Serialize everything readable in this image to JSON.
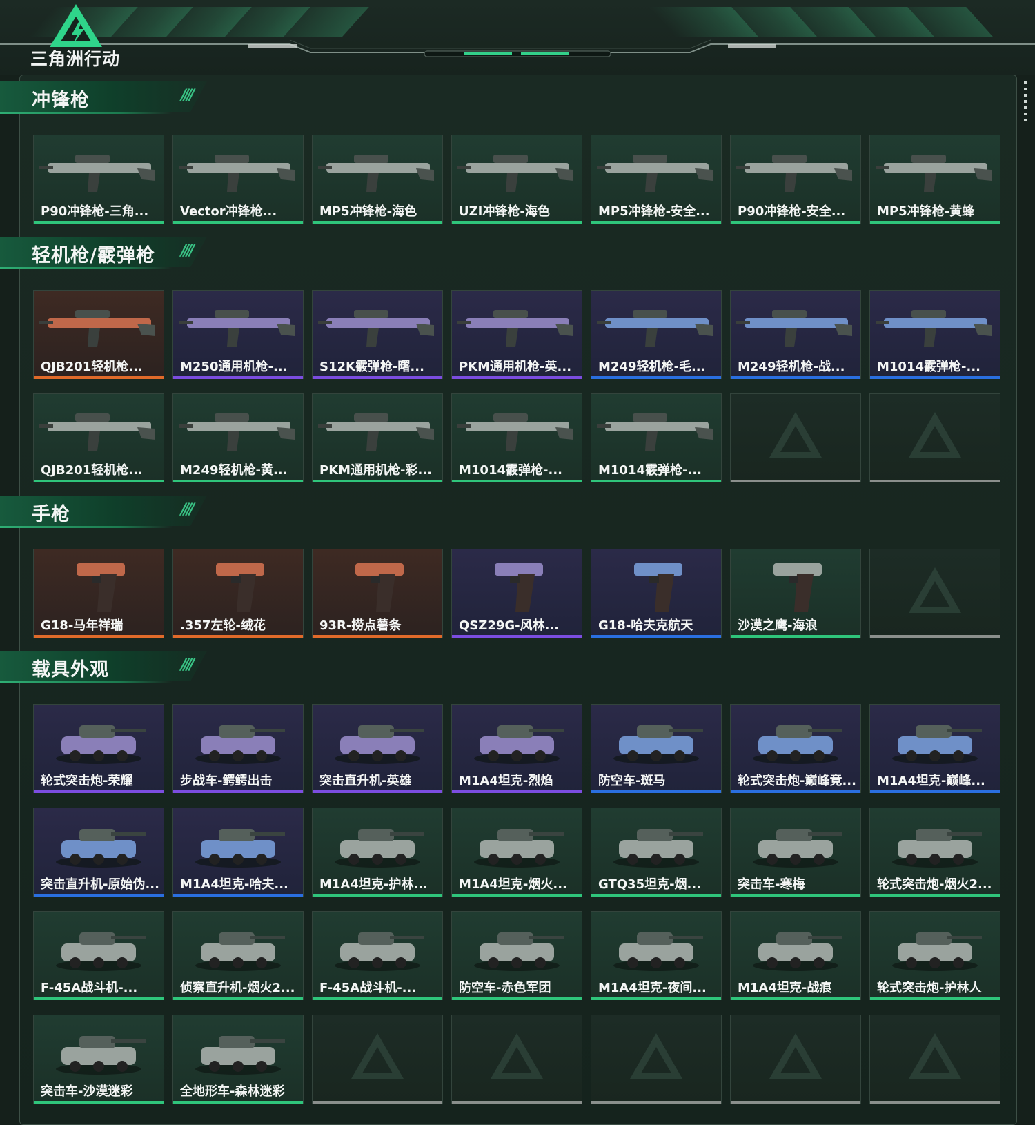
{
  "app": {
    "logo_text": "三角洲行动",
    "logo_icon": "delta-triangle-icon"
  },
  "colors": {
    "green": "#2fc57b",
    "purple": "#7b4de0",
    "blue": "#2a6fe0",
    "orange": "#e06a2a",
    "gray": "#8a8f8c"
  },
  "sections": [
    {
      "title": "冲锋枪",
      "rows": [
        [
          {
            "name": "P90冲锋枪-三角...",
            "rarity": "green"
          },
          {
            "name": "Vector冲锋枪...",
            "rarity": "green"
          },
          {
            "name": "MP5冲锋枪-海色",
            "rarity": "green"
          },
          {
            "name": "UZI冲锋枪-海色",
            "rarity": "green"
          },
          {
            "name": "MP5冲锋枪-安全...",
            "rarity": "green"
          },
          {
            "name": "P90冲锋枪-安全...",
            "rarity": "green"
          },
          {
            "name": "MP5冲锋枪-黄蜂",
            "rarity": "green"
          }
        ]
      ]
    },
    {
      "title": "轻机枪/霰弹枪",
      "rows": [
        [
          {
            "name": "QJB201轻机枪...",
            "rarity": "orange"
          },
          {
            "name": "M250通用机枪-...",
            "rarity": "purple"
          },
          {
            "name": "S12K霰弹枪-曙...",
            "rarity": "purple"
          },
          {
            "name": "PKM通用机枪-英...",
            "rarity": "purple"
          },
          {
            "name": "M249轻机枪-毛...",
            "rarity": "blue"
          },
          {
            "name": "M249轻机枪-战...",
            "rarity": "blue"
          },
          {
            "name": "M1014霰弹枪-...",
            "rarity": "blue"
          }
        ],
        [
          {
            "name": "QJB201轻机枪...",
            "rarity": "green"
          },
          {
            "name": "M249轻机枪-黄...",
            "rarity": "green"
          },
          {
            "name": "PKM通用机枪-彩...",
            "rarity": "green"
          },
          {
            "name": "M1014霰弹枪-...",
            "rarity": "green"
          },
          {
            "name": "M1014霰弹枪-...",
            "rarity": "green"
          },
          {
            "name": "",
            "rarity": "empty"
          },
          {
            "name": "",
            "rarity": "empty"
          }
        ]
      ]
    },
    {
      "title": "手枪",
      "rows": [
        [
          {
            "name": "G18-马年祥瑞",
            "rarity": "orange"
          },
          {
            "name": ".357左轮-绒花",
            "rarity": "orange"
          },
          {
            "name": "93R-捞点薯条",
            "rarity": "orange"
          },
          {
            "name": "QSZ29G-风林...",
            "rarity": "purple"
          },
          {
            "name": "G18-哈夫克航天",
            "rarity": "blue"
          },
          {
            "name": "沙漠之鹰-海浪",
            "rarity": "green"
          },
          {
            "name": "",
            "rarity": "empty"
          }
        ]
      ]
    },
    {
      "title": "载具外观",
      "rows": [
        [
          {
            "name": "轮式突击炮-荣耀",
            "rarity": "purple"
          },
          {
            "name": "步战车-鳄鳄出击",
            "rarity": "purple"
          },
          {
            "name": "突击直升机-英雄",
            "rarity": "purple"
          },
          {
            "name": "M1A4坦克-烈焰",
            "rarity": "purple"
          },
          {
            "name": "防空车-斑马",
            "rarity": "blue"
          },
          {
            "name": "轮式突击炮-巅峰竞...",
            "rarity": "blue"
          },
          {
            "name": "M1A4坦克-巅峰...",
            "rarity": "blue"
          }
        ],
        [
          {
            "name": "突击直升机-原始伪...",
            "rarity": "blue"
          },
          {
            "name": "M1A4坦克-哈夫...",
            "rarity": "blue"
          },
          {
            "name": "M1A4坦克-护林...",
            "rarity": "green"
          },
          {
            "name": "M1A4坦克-烟火...",
            "rarity": "green"
          },
          {
            "name": "GTQ35坦克-烟...",
            "rarity": "green"
          },
          {
            "name": "突击车-寒梅",
            "rarity": "green"
          },
          {
            "name": "轮式突击炮-烟火2...",
            "rarity": "green"
          }
        ],
        [
          {
            "name": "F-45A战斗机-...",
            "rarity": "green"
          },
          {
            "name": "侦察直升机-烟火2...",
            "rarity": "green"
          },
          {
            "name": "F-45A战斗机-...",
            "rarity": "green"
          },
          {
            "name": "防空车-赤色军团",
            "rarity": "green"
          },
          {
            "name": "M1A4坦克-夜间...",
            "rarity": "green"
          },
          {
            "name": "M1A4坦克-战痕",
            "rarity": "green"
          },
          {
            "name": "轮式突击炮-护林人",
            "rarity": "green"
          }
        ],
        [
          {
            "name": "突击车-沙漠迷彩",
            "rarity": "green"
          },
          {
            "name": "全地形车-森林迷彩",
            "rarity": "green"
          },
          {
            "name": "",
            "rarity": "empty"
          },
          {
            "name": "",
            "rarity": "empty"
          },
          {
            "name": "",
            "rarity": "empty"
          },
          {
            "name": "",
            "rarity": "empty"
          },
          {
            "name": "",
            "rarity": "empty"
          }
        ]
      ]
    }
  ]
}
